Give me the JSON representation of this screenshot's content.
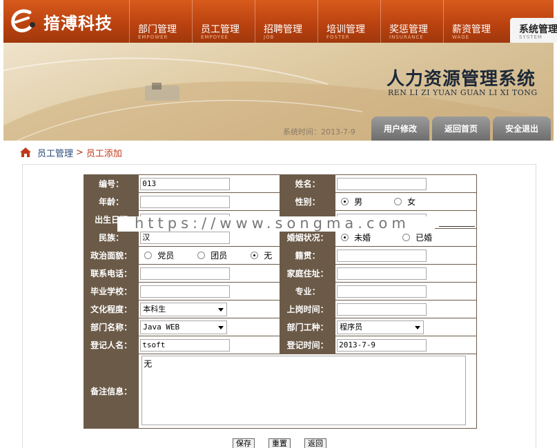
{
  "brand": {
    "logo_text": "揞溥科技"
  },
  "nav": [
    {
      "cn": "部门管理",
      "en": "EMPOWER"
    },
    {
      "cn": "员工管理",
      "en": "EMPOYEE"
    },
    {
      "cn": "招聘管理",
      "en": "JOB"
    },
    {
      "cn": "培训管理",
      "en": "FOSTER"
    },
    {
      "cn": "奖惩管理",
      "en": "INSURANCE"
    },
    {
      "cn": "薪资管理",
      "en": "WAGE"
    },
    {
      "cn": "系统管理",
      "en": "SYSTEM"
    }
  ],
  "banner": {
    "title": "人力资源管理系统",
    "pinyin": "REN LI ZI YUAN GUAN LI XI TONG",
    "time_label": "系统时间：",
    "time_value": "2013-7-9",
    "buttons": [
      "用户修改",
      "返回首页",
      "安全退出"
    ]
  },
  "breadcrumb": {
    "section": "员工管理",
    "sep": ">",
    "page": "员工添加"
  },
  "form": {
    "labels": {
      "id": "编号：",
      "name": "姓名：",
      "age": "年龄：",
      "gender": "性别：",
      "birth": "出生日期",
      "nation": "民族：",
      "marital": "婚姻状况：",
      "political": "政治面貌：",
      "native": "籍贯：",
      "phone": "联系电话：",
      "address": "家庭住址：",
      "school": "毕业学校：",
      "major": "专业：",
      "education": "文化程度：",
      "onboard": "上岗时间：",
      "dept": "部门名称：",
      "jobtype": "部门工种：",
      "registrar": "登记人名：",
      "regtime": "登记时间：",
      "remark": "备注信息："
    },
    "values": {
      "id": "013",
      "name": "",
      "age": "",
      "birth": "",
      "nation": "汉",
      "native": "",
      "phone": "",
      "address": "",
      "school": "",
      "major": "",
      "onboard": "",
      "registrar": "tsoft",
      "regtime": "2013-7-9",
      "remark": "无"
    },
    "gender": {
      "options": [
        "男",
        "女"
      ],
      "selected": "男"
    },
    "marital": {
      "options": [
        "未婚",
        "已婚"
      ],
      "selected": "未婚"
    },
    "political": {
      "options": [
        "党员",
        "团员",
        "无"
      ],
      "selected": "无"
    },
    "education": {
      "selected": "本科生"
    },
    "dept": {
      "selected": "Java WEB"
    },
    "jobtype": {
      "selected": "程序员"
    },
    "buttons": {
      "save": "保存",
      "reset": "重置",
      "back": "返回"
    }
  },
  "watermark": {
    "text": "https://www.songma.com"
  },
  "colors": {
    "header_orange": "#c4501a",
    "label_bg": "#6b5a47",
    "title_dark": "#1c2838",
    "breadcrumb_red": "#c0391b"
  }
}
